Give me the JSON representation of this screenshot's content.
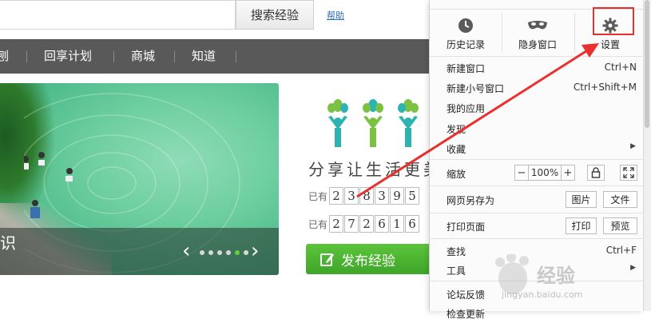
{
  "search": {
    "button_label": "搜索经验",
    "help_label": "帮助"
  },
  "nav": {
    "items": [
      "刨",
      "回享计划",
      "商城",
      "知道"
    ]
  },
  "banner": {
    "caption": "识",
    "slide_count": 6,
    "active_slide": 5
  },
  "hero": {
    "slogan": "分享让生活更美",
    "counter1": {
      "label": "已有",
      "digits": [
        "2",
        "3",
        "8",
        "3",
        "9",
        "5"
      ]
    },
    "counter2": {
      "label": "已有",
      "digits": [
        "2",
        "7",
        "2",
        "6",
        "1",
        "6"
      ]
    },
    "publish_label": "发布经验"
  },
  "menu": {
    "quick": {
      "history": "历史记录",
      "incognito": "隐身窗口",
      "settings": "设置"
    },
    "items": {
      "new_window": {
        "label": "新建窗口",
        "shortcut": "Ctrl+N"
      },
      "new_small_window": {
        "label": "新建小号窗口",
        "shortcut": "Ctrl+Shift+M"
      },
      "my_apps": {
        "label": "我的应用"
      },
      "discover": {
        "label": "发现"
      },
      "favorites": {
        "label": "收藏"
      },
      "zoom": {
        "label": "缩放",
        "minus": "−",
        "value": "100%",
        "plus": "+"
      },
      "save_as": {
        "label": "网页另存为",
        "btn1": "图片",
        "btn2": "文件"
      },
      "print": {
        "label": "打印页面",
        "btn1": "打印",
        "btn2": "预览"
      },
      "find": {
        "label": "查找",
        "shortcut": "Ctrl+F"
      },
      "tools": {
        "label": "工具"
      },
      "forum": {
        "label": "论坛反馈"
      },
      "check_update": {
        "label": "检查更新"
      }
    }
  },
  "watermark": {
    "text": "经验",
    "url": "jingyan.baidu.com"
  },
  "colors": {
    "nav_bg": "#595959",
    "publish_green": "#4cb431",
    "highlight_red": "#e8312e",
    "logo_green": "#7cc242",
    "logo_teal": "#2db3b0"
  }
}
